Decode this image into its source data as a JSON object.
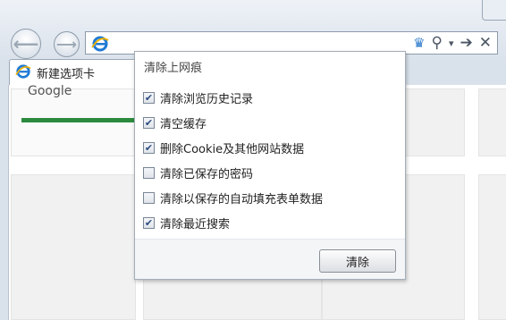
{
  "browser": {
    "tab_label": "新建选项卡",
    "tile_text": "Google",
    "icons": [
      "back-arrow-icon",
      "forward-arrow-icon",
      "ie-logo-icon",
      "broom-icon",
      "search-icon",
      "dropdown-icon",
      "go-arrow-icon",
      "close-icon"
    ]
  },
  "dialog": {
    "title": "清除上网痕",
    "options": [
      {
        "label": "清除浏览历史记录",
        "checked": true
      },
      {
        "label": "清空缓存",
        "checked": true
      },
      {
        "label": "删除Cookie及其他网站数据",
        "checked": true
      },
      {
        "label": "清除已保存的密码",
        "checked": false
      },
      {
        "label": "清除以保存的自动填充表单数据",
        "checked": false
      },
      {
        "label": "清除最近搜索",
        "checked": true
      }
    ],
    "clear_button": "清除"
  }
}
